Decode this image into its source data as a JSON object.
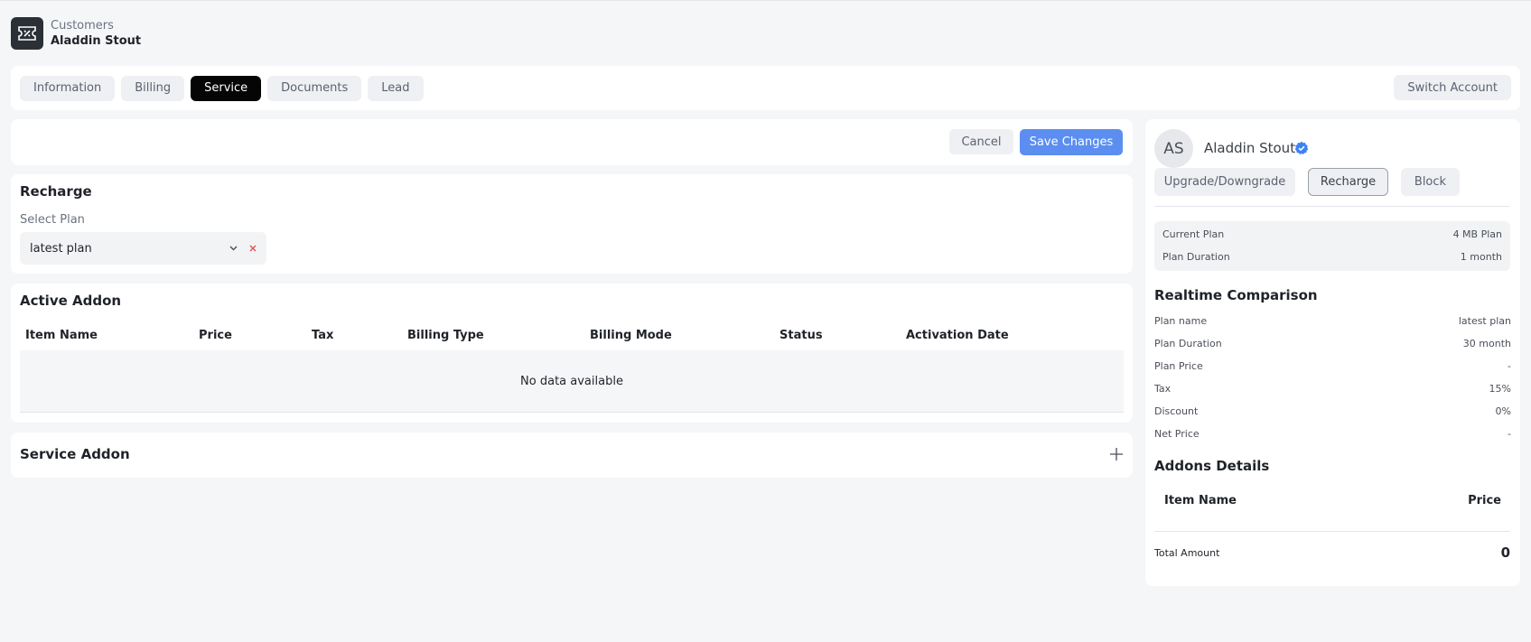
{
  "header": {
    "breadcrumb": "Customers",
    "customer_name": "Aladdin Stout",
    "logo_icon": "ticket-icon"
  },
  "tabs": [
    {
      "label": "Information",
      "active": false
    },
    {
      "label": "Billing",
      "active": false
    },
    {
      "label": "Service",
      "active": true
    },
    {
      "label": "Documents",
      "active": false
    },
    {
      "label": "Lead",
      "active": false
    }
  ],
  "switch_account_label": "Switch Account",
  "actions": {
    "cancel_label": "Cancel",
    "save_label": "Save Changes"
  },
  "recharge": {
    "title": "Recharge",
    "select_label": "Select Plan",
    "select_value": "latest plan"
  },
  "active_addon": {
    "title": "Active Addon",
    "columns": [
      "Item Name",
      "Price",
      "Tax",
      "Billing Type",
      "Billing Mode",
      "Status",
      "Activation Date"
    ],
    "empty_text": "No data available"
  },
  "service_addon": {
    "title": "Service Addon"
  },
  "profile": {
    "initials": "AS",
    "name": "Aladdin Stout",
    "buttons": {
      "upgrade": "Upgrade/Downgrade",
      "recharge": "Recharge",
      "block": "Block"
    },
    "current_plan": {
      "label": "Current Plan",
      "value": "4 MB Plan"
    },
    "plan_duration": {
      "label": "Plan Duration",
      "value": "1 month"
    }
  },
  "comparison": {
    "title": "Realtime Comparison",
    "rows": [
      {
        "label": "Plan name",
        "value": "latest plan"
      },
      {
        "label": "Plan Duration",
        "value": "30 month"
      },
      {
        "label": "Plan Price",
        "value": "-"
      },
      {
        "label": "Tax",
        "value": "15%"
      },
      {
        "label": "Discount",
        "value": "0%"
      },
      {
        "label": "Net Price",
        "value": "-"
      }
    ]
  },
  "addons_details": {
    "title": "Addons Details",
    "col_item": "Item Name",
    "col_price": "Price",
    "total_label": "Total Amount",
    "total_value": "0"
  },
  "colors": {
    "primary": "#5b8ef0",
    "active_tab": "#050505",
    "verified": "#3b82f6",
    "clear": "#e05252"
  }
}
